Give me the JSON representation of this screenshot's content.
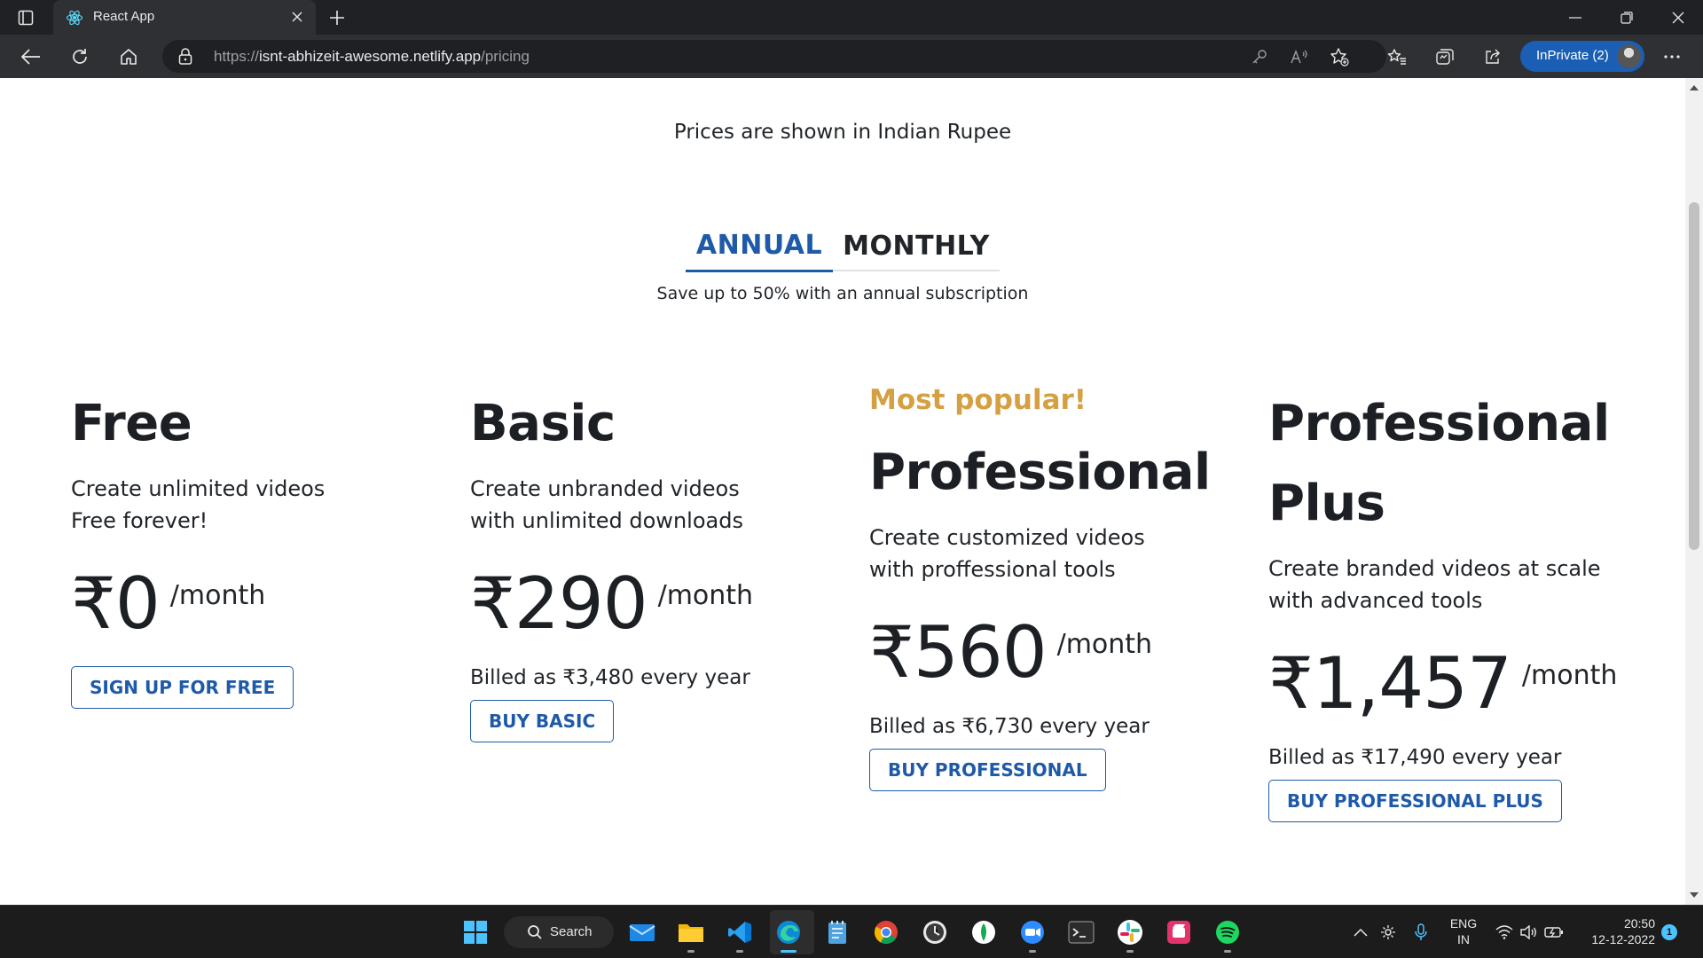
{
  "browser": {
    "tab_title": "React App",
    "url_prefix": "https://",
    "url_host": "isnt-abhizeit-awesome.netlify.app",
    "url_path": "/pricing",
    "inprivate_label": "InPrivate (2)"
  },
  "pricing": {
    "currency_note": "Prices are shown in Indian Rupee",
    "tabs": {
      "annual": "ANNUAL",
      "monthly": "MONTHLY",
      "active": "annual"
    },
    "save_note": "Save up to 50% with an annual subscription",
    "plans": [
      {
        "name": "Free",
        "description": "Create unlimited videos Free forever!",
        "price": "₹0",
        "period": "/month",
        "billed": "",
        "button": "SIGN UP FOR FREE"
      },
      {
        "name": "Basic",
        "description": "Create unbranded videos with unlimited downloads",
        "price": "₹290",
        "period": "/month",
        "billed": "Billed as ₹3,480 every year",
        "button": "BUY BASIC"
      },
      {
        "badge": "Most popular!",
        "name": "Professional",
        "description": "Create customized videos with proffessional tools",
        "price": "₹560",
        "period": "/month",
        "billed": "Billed as ₹6,730 every year",
        "button": "BUY PROFESSIONAL"
      },
      {
        "name": "Professional Plus",
        "description": "Create branded videos at scale with advanced tools",
        "price": "₹1,457",
        "period": "/month",
        "billed": "Billed as ₹17,490 every year",
        "button": "BUY PROFESSIONAL PLUS"
      }
    ]
  },
  "taskbar": {
    "search_label": "Search",
    "apps": [
      "start-icon",
      "mail-icon",
      "file-explorer-icon",
      "vscode-icon",
      "edge-icon",
      "notepad-icon",
      "chrome-icon",
      "clock-app-icon",
      "mongodb-compass-icon",
      "zoom-icon",
      "terminal-icon",
      "slack-icon",
      "clipchamp-icon",
      "spotify-icon"
    ],
    "language": "ENG",
    "region": "IN",
    "time": "20:50",
    "date": "12-12-2022",
    "notifications": "1"
  },
  "colors": {
    "accent": "#1f5aa8",
    "popular": "#d4a042",
    "chrome_dark": "#202124",
    "inprivate": "#1a5fb4"
  }
}
